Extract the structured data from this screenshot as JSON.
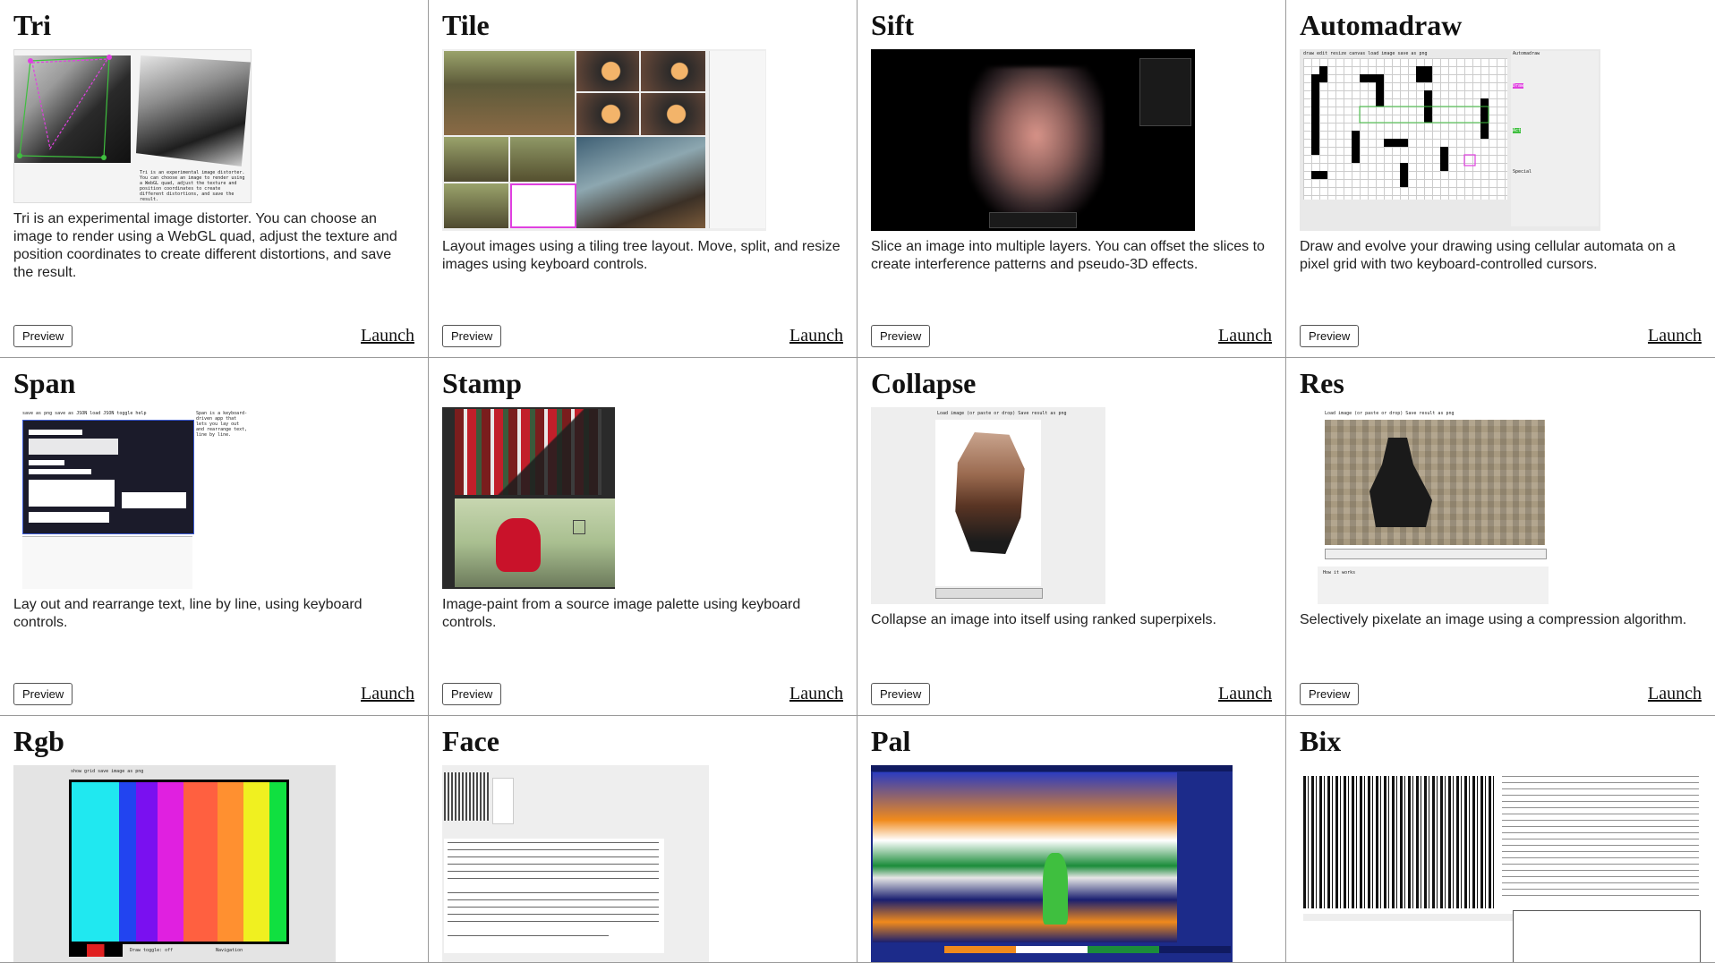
{
  "apps": [
    {
      "title": "Tri",
      "description": "Tri is an experimental image distorter. You can choose an image to render using a WebGL quad, adjust the texture and position coordinates to create different distortions, and save the result.",
      "preview_label": "Preview",
      "launch_label": "Launch"
    },
    {
      "title": "Tile",
      "description": "Layout images using a tiling tree layout. Move, split, and resize images using keyboard controls.",
      "preview_label": "Preview",
      "launch_label": "Launch"
    },
    {
      "title": "Sift",
      "description": "Slice an image into multiple layers. You can offset the slices to create interference patterns and pseudo-3D effects.",
      "preview_label": "Preview",
      "launch_label": "Launch"
    },
    {
      "title": "Automadraw",
      "description": "Draw and evolve your drawing using cellular automata on a pixel grid with two keyboard-controlled cursors.",
      "preview_label": "Preview",
      "launch_label": "Launch"
    },
    {
      "title": "Span",
      "description": "Lay out and rearrange text, line by line, using keyboard controls.",
      "preview_label": "Preview",
      "launch_label": "Launch"
    },
    {
      "title": "Stamp",
      "description": "Image-paint from a source image palette using keyboard controls.",
      "preview_label": "Preview",
      "launch_label": "Launch"
    },
    {
      "title": "Collapse",
      "description": "Collapse an image into itself using ranked superpixels.",
      "preview_label": "Preview",
      "launch_label": "Launch"
    },
    {
      "title": "Res",
      "description": "Selectively pixelate an image using a compression algorithm.",
      "preview_label": "Preview",
      "launch_label": "Launch"
    },
    {
      "title": "Rgb",
      "description": "",
      "preview_label": "Preview",
      "launch_label": "Launch"
    },
    {
      "title": "Face",
      "description": "",
      "preview_label": "Preview",
      "launch_label": "Launch"
    },
    {
      "title": "Pal",
      "description": "",
      "preview_label": "Preview",
      "launch_label": "Launch"
    },
    {
      "title": "Bix",
      "description": "",
      "preview_label": "Preview",
      "launch_label": "Launch"
    }
  ],
  "thumb_text": {
    "tri_caption": "Tri is an experimental image distorter. You can choose an image to render using a WebGL quad, adjust the texture and position coordinates to create different distortions, and save the result.",
    "rgb_toolbar_a": "show grid",
    "rgb_toolbar_b": "save image as png",
    "rgb_draw_toggle": "Draw toggle: off",
    "rgb_navigation": "Navigation",
    "collapse_toolbar": "Load image (or paste or drop)  Save result as png",
    "res_toolbar": "Load image (or paste or drop)  Save result as png",
    "res_how": "How it works",
    "automadraw_toolbar": "draw  edit  resize canvas      load image  save as png",
    "automadraw_panel_title": "Automadraw",
    "automadraw_draw": "Draw",
    "automadraw_act": "Act",
    "automadraw_special": "Special",
    "span_toolbar": "save as png  save as JSON  load JSON  toggle help",
    "span_help": "Span is a keyboard-driven app that lets you lay out and rearrange text, line by line."
  },
  "colors": {
    "magenta": "#e040e0",
    "green": "#3fbf3f",
    "sift_bg": "#000000",
    "pal_blue": "#1c2b8a",
    "pal_orange": "#f08a1c"
  }
}
